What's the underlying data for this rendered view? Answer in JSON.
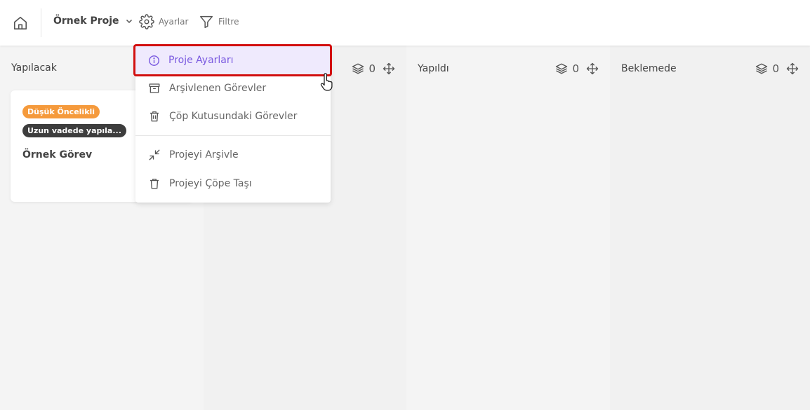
{
  "header": {
    "project_name": "Örnek Proje",
    "settings_label": "Ayarlar",
    "filter_label": "Filtre"
  },
  "columns": [
    {
      "name": "Yapılacak",
      "count": null
    },
    {
      "name": "",
      "count": "0"
    },
    {
      "name": "Yapıldı",
      "count": "0"
    },
    {
      "name": "Beklemede",
      "count": "0"
    }
  ],
  "card": {
    "priority_tag": "Düşük Öncelikli",
    "label_tag": "Uzun vadede yapıla...",
    "title": "Örnek Görev",
    "colors": {
      "priority": "#f59a3c",
      "label": "#3d3d3d"
    }
  },
  "menu": {
    "items": [
      {
        "label": "Proje Ayarları",
        "icon": "info-icon",
        "active": true
      },
      {
        "label": "Arşivlenen Görevler",
        "icon": "archive-box-icon"
      },
      {
        "label": "Çöp Kutusundaki Görevler",
        "icon": "trash-icon"
      },
      {
        "label": "Projeyi Arşivle",
        "icon": "collapse-arrows-icon"
      },
      {
        "label": "Projeyi Çöpe Taşı",
        "icon": "trash-icon"
      }
    ]
  },
  "colors": {
    "accent": "#7a5ae0",
    "active_bg": "#efeafd",
    "highlight": "#d20f0f"
  }
}
